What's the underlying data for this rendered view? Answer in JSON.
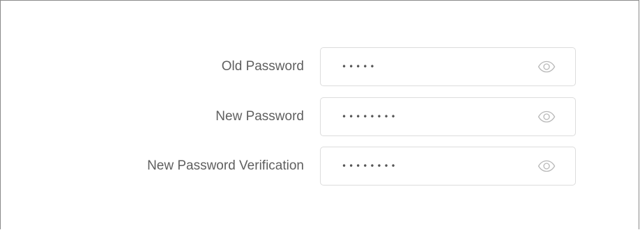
{
  "form": {
    "fields": [
      {
        "label": "Old Password",
        "value": "•••••",
        "toggle_icon": "eye-icon"
      },
      {
        "label": "New Password",
        "value": "••••••••",
        "toggle_icon": "eye-icon"
      },
      {
        "label": "New Password Verification",
        "value": "••••••••",
        "toggle_icon": "eye-icon"
      }
    ]
  },
  "colors": {
    "label": "#5f5f5f",
    "border": "#dcdcdc",
    "icon": "#b8b8b8"
  }
}
